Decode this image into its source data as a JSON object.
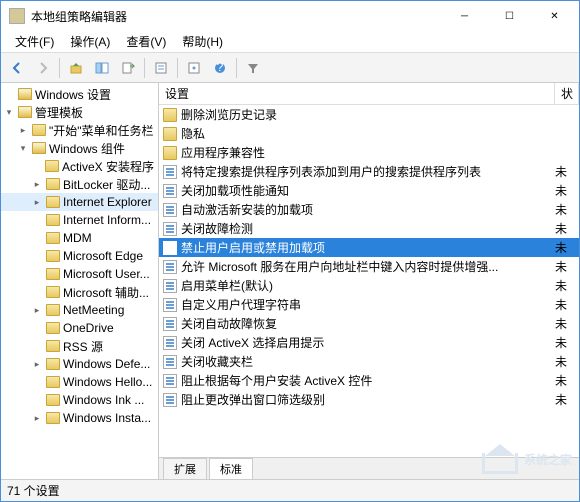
{
  "window": {
    "title": "本地组策略编辑器"
  },
  "menu": {
    "file": "文件(F)",
    "action": "操作(A)",
    "view": "查看(V)",
    "help": "帮助(H)"
  },
  "toolbar_icons": [
    "back",
    "forward",
    "up",
    "show-hide-tree",
    "export",
    "refresh",
    "properties",
    "help",
    "filter"
  ],
  "tree": [
    {
      "label": "Windows 设置",
      "depth": 0,
      "toggle": "",
      "icon": "open",
      "selected": false
    },
    {
      "label": "管理模板",
      "depth": 0,
      "toggle": "▾",
      "icon": "open",
      "selected": false
    },
    {
      "label": "\"开始\"菜单和任务栏",
      "depth": 1,
      "toggle": "▸",
      "icon": "closed",
      "selected": false
    },
    {
      "label": "Windows 组件",
      "depth": 1,
      "toggle": "▾",
      "icon": "open",
      "selected": false
    },
    {
      "label": "ActiveX 安装程序",
      "depth": 2,
      "toggle": "",
      "icon": "closed",
      "selected": false
    },
    {
      "label": "BitLocker 驱动...",
      "depth": 2,
      "toggle": "▸",
      "icon": "closed",
      "selected": false
    },
    {
      "label": "Internet Explorer",
      "depth": 2,
      "toggle": "▸",
      "icon": "closed",
      "selected": true
    },
    {
      "label": "Internet Inform...",
      "depth": 2,
      "toggle": "",
      "icon": "closed",
      "selected": false
    },
    {
      "label": "MDM",
      "depth": 2,
      "toggle": "",
      "icon": "closed",
      "selected": false
    },
    {
      "label": "Microsoft Edge",
      "depth": 2,
      "toggle": "",
      "icon": "closed",
      "selected": false
    },
    {
      "label": "Microsoft User...",
      "depth": 2,
      "toggle": "",
      "icon": "closed",
      "selected": false
    },
    {
      "label": "Microsoft 辅助...",
      "depth": 2,
      "toggle": "",
      "icon": "closed",
      "selected": false
    },
    {
      "label": "NetMeeting",
      "depth": 2,
      "toggle": "▸",
      "icon": "closed",
      "selected": false
    },
    {
      "label": "OneDrive",
      "depth": 2,
      "toggle": "",
      "icon": "closed",
      "selected": false
    },
    {
      "label": "RSS 源",
      "depth": 2,
      "toggle": "",
      "icon": "closed",
      "selected": false
    },
    {
      "label": "Windows Defe...",
      "depth": 2,
      "toggle": "▸",
      "icon": "closed",
      "selected": false
    },
    {
      "label": "Windows Hello...",
      "depth": 2,
      "toggle": "",
      "icon": "closed",
      "selected": false
    },
    {
      "label": "Windows Ink ...",
      "depth": 2,
      "toggle": "",
      "icon": "closed",
      "selected": false
    },
    {
      "label": "Windows Insta...",
      "depth": 2,
      "toggle": "▸",
      "icon": "closed",
      "selected": false
    }
  ],
  "list_header": {
    "col_setting": "设置",
    "col_state": "状"
  },
  "list": [
    {
      "type": "folder",
      "label": "删除浏览历史记录",
      "state": ""
    },
    {
      "type": "folder",
      "label": "隐私",
      "state": ""
    },
    {
      "type": "folder",
      "label": "应用程序兼容性",
      "state": ""
    },
    {
      "type": "setting",
      "label": "将特定搜索提供程序列表添加到用户的搜索提供程序列表",
      "state": "未"
    },
    {
      "type": "setting",
      "label": "关闭加载项性能通知",
      "state": "未"
    },
    {
      "type": "setting",
      "label": "自动激活新安装的加载项",
      "state": "未"
    },
    {
      "type": "setting",
      "label": "关闭故障检测",
      "state": "未"
    },
    {
      "type": "setting",
      "label": "禁止用户启用或禁用加载项",
      "state": "未",
      "selected": true
    },
    {
      "type": "setting",
      "label": "允许 Microsoft 服务在用户向地址栏中键入内容时提供增强...",
      "state": "未"
    },
    {
      "type": "setting",
      "label": "启用菜单栏(默认)",
      "state": "未"
    },
    {
      "type": "setting",
      "label": "自定义用户代理字符串",
      "state": "未"
    },
    {
      "type": "setting",
      "label": "关闭自动故障恢复",
      "state": "未"
    },
    {
      "type": "setting",
      "label": "关闭 ActiveX 选择启用提示",
      "state": "未"
    },
    {
      "type": "setting",
      "label": "关闭收藏夹栏",
      "state": "未"
    },
    {
      "type": "setting",
      "label": "阻止根据每个用户安装 ActiveX 控件",
      "state": "未"
    },
    {
      "type": "setting",
      "label": "阻止更改弹出窗口筛选级别",
      "state": "未"
    }
  ],
  "tabs": {
    "extended": "扩展",
    "standard": "标准"
  },
  "status": {
    "count": "71 个设置"
  },
  "watermark": "系统之家"
}
